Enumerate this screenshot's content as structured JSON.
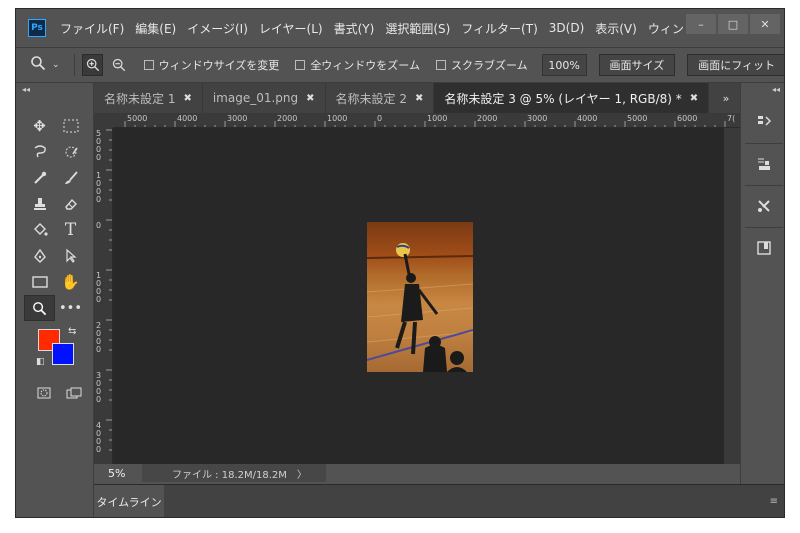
{
  "app": {
    "logo": "Ps"
  },
  "menu": [
    "ファイル(F)",
    "編集(E)",
    "イメージ(I)",
    "レイヤー(L)",
    "書式(Y)",
    "選択範囲(S)",
    "フィルター(T)",
    "3D(D)",
    "表示(V)",
    "ウィンドウ"
  ],
  "window_controls": {
    "minimize": "–",
    "maximize": "□",
    "close": "✕"
  },
  "options": {
    "resize_windows": "ウィンドウサイズを変更",
    "zoom_all": "全ウィンドウをズーム",
    "scrubby_zoom": "スクラブズーム",
    "zoom_value": "100%",
    "fit_screen": "画面サイズ",
    "fill_screen": "画面にフィット"
  },
  "tabs": [
    {
      "label": "名称未設定 1",
      "active": false
    },
    {
      "label": "image_01.png",
      "active": false
    },
    {
      "label": "名称未設定 2",
      "active": false
    },
    {
      "label": "名称未設定 3 @ 5% (レイヤー 1, RGB/8) *",
      "active": true
    }
  ],
  "tab_overflow": "»",
  "ruler": {
    "h": [
      "5000",
      "4000",
      "3000",
      "2000",
      "1000",
      "0",
      "1000",
      "2000",
      "3000",
      "4000",
      "5000",
      "6000",
      "7("
    ],
    "v": [
      "5\n0\n0\n0",
      "1\n0\n0\n0",
      "0",
      "1\n0\n0\n0",
      "2\n0\n0\n0",
      "3\n0\n0\n0",
      "4\n0\n0\n0"
    ]
  },
  "colors": {
    "foreground": "#ff2a00",
    "background": "#0011ff",
    "accent": "#31a8ff"
  },
  "status": {
    "zoom": "5%",
    "file": "ファイル : 18.2M/18.2M",
    "arrow": "〉"
  },
  "timeline": {
    "label": "タイムライン",
    "menu": "≡"
  }
}
